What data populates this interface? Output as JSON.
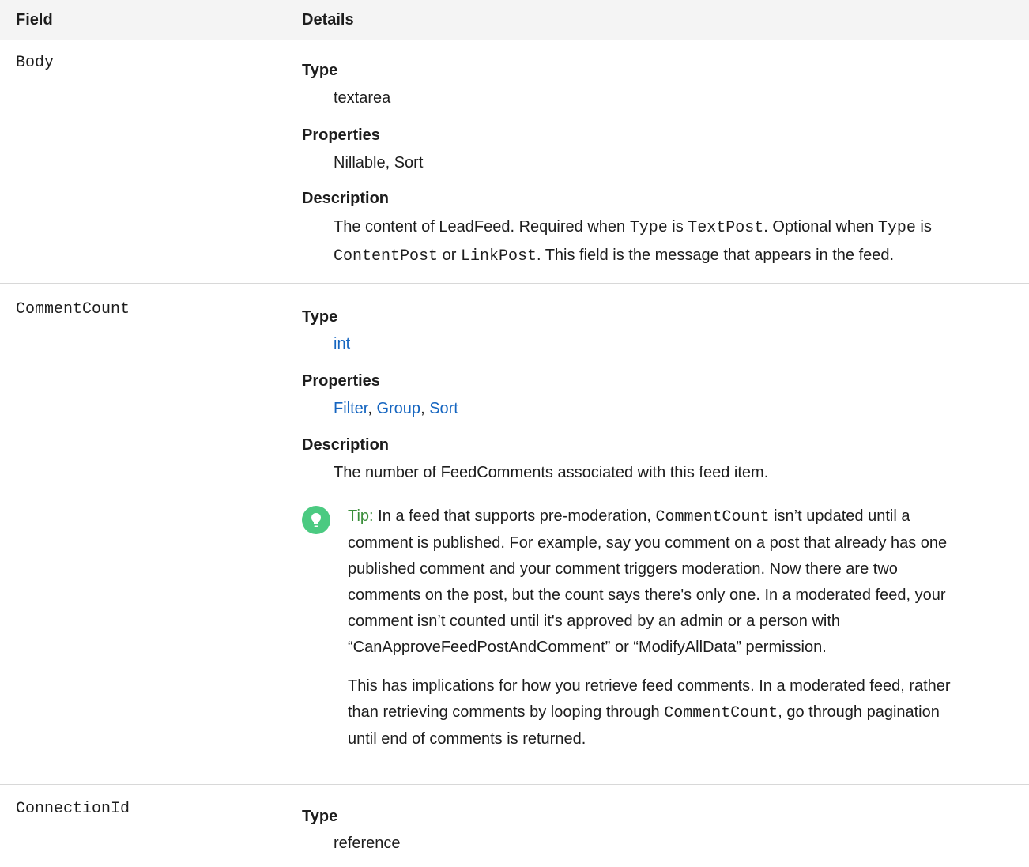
{
  "header": {
    "field": "Field",
    "details": "Details"
  },
  "rows": [
    {
      "name": "Body",
      "type_label": "Type",
      "type_value": "textarea",
      "props_label": "Properties",
      "props_value": "Nillable, Sort",
      "desc_label": "Description",
      "desc_parts": {
        "p1": "The content of LeadFeed. Required when ",
        "c1": "Type",
        "p2": " is ",
        "c2": "TextPost",
        "p3": ". Optional when ",
        "c3": "Type",
        "p4": " is",
        "c4": "ContentPost",
        "p5": " or ",
        "c5": "LinkPost",
        "p6": ". This field is the message that appears in the feed."
      }
    },
    {
      "name": "CommentCount",
      "type_label": "Type",
      "type_value": "int",
      "props_label": "Properties",
      "props_links": [
        "Filter",
        "Group",
        "Sort"
      ],
      "desc_label": "Description",
      "desc_value": "The number of FeedComments associated with this feed item.",
      "tip": {
        "label": "Tip:",
        "line1_a": "In a feed that supports pre-moderation,",
        "line1_code": "CommentCount",
        "line1_b": "isn’t updated until a",
        "rest": [
          "comment is published. For example, say you comment on a post that already has one",
          "published comment and your comment triggers moderation. Now there are two",
          "comments on the post, but the count says there's only one. In a moderated feed, your",
          "comment isn’t counted until it's approved by an admin or a person with",
          "“CanApproveFeedPostAndComment” or “ModifyAllData” permission."
        ],
        "para2_line1": "This has implications for how you retrieve feed comments. In a moderated feed, rather",
        "para2_line2_a": "than retrieving comments by looping through",
        "para2_line2_code": "CommentCount",
        "para2_line2_b": ", go through pagination",
        "para2_line3": "until end of comments is returned."
      }
    },
    {
      "name": "ConnectionId",
      "type_label": "Type",
      "type_value": "reference"
    }
  ],
  "icons": {
    "tip": "lightbulb-icon"
  },
  "colors": {
    "link": "#1565c0",
    "tip_green": "#4bca81",
    "header_bg": "#f4f4f4"
  }
}
